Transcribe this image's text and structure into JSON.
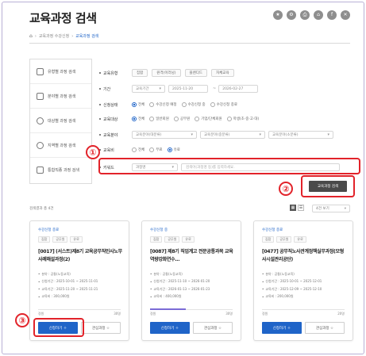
{
  "page": {
    "title": "교육과정 검색",
    "share_icons": [
      "★",
      "⚙",
      "⎙",
      "⌂",
      "f",
      "✕"
    ]
  },
  "breadcrumb": {
    "home_icon": "⌂",
    "items": [
      "교육과정 수강신청",
      "교육과정 검색"
    ]
  },
  "left_menu": [
    {
      "label": "유형별 과정 검색",
      "icon": "calendar-icon"
    },
    {
      "label": "분야별 과정 검색",
      "icon": "book-icon"
    },
    {
      "label": "대상별 과정 검색",
      "icon": "people-icon"
    },
    {
      "label": "지역별 과정 검색",
      "icon": "globe-icon"
    },
    {
      "label": "통합직종 과정 검색",
      "icon": "document-icon"
    }
  ],
  "filters": {
    "edu_type": {
      "label": "교육유형",
      "chips": [
        "집합",
        "원격(이러닝)",
        "블렌디드",
        "자체교육"
      ]
    },
    "period": {
      "label": "기간",
      "select": "교육기간",
      "start": "2025-11-20",
      "end": "2026-02-27"
    },
    "apply_status": {
      "label": "신청상태",
      "options": [
        "전체",
        "수강신청 예정",
        "수강신청 중",
        "수강신청 종료"
      ],
      "selected": 0
    },
    "edu_target": {
      "label": "교육대상",
      "options": [
        "전체",
        "일반회원",
        "공무원",
        "기업/단체회원",
        "학생(초·중·고·대)"
      ],
      "selected": 0
    },
    "edu_field": {
      "label": "교육분야",
      "selects": [
        "교육분야(대분류)",
        "교육분야(중분류)",
        "교육분야(소분류)"
      ]
    },
    "edu_cost": {
      "label": "교육비",
      "options": [
        "전체",
        "무료",
        "유료"
      ],
      "selected": 2
    },
    "keyword": {
      "label": "키워드",
      "select": "과정명",
      "placeholder": "검색어(과정명 등)를 입력하세요."
    }
  },
  "search_button": "교육과정 검색",
  "results": {
    "count_text": "검색결과 총 4건",
    "view_toggle": [
      "▦",
      "☰"
    ],
    "per_page": "4건 보기"
  },
  "cards": [
    {
      "status": "수강신청 종료",
      "tags": [
        "집합",
        "공무원",
        "유료"
      ],
      "title": "[0017] (서스트)제8기 교육공무직인사노무사례해설과정(2)",
      "info": [
        "분야 : 공통(노동교육)",
        "신청기간 : 2025-10-01 ~ 2025-11-01",
        "교육기간 : 2025-11-20 ~ 2025-11-21",
        "교육비 : 300,000원"
      ],
      "cap_left": "정원",
      "cap_right": "30명",
      "progress": 0,
      "apply": "신청하기 ＋",
      "fav": "관심과정 ☆"
    },
    {
      "status": "수강신청 중",
      "tags": [
        "집합",
        "공무원",
        "유료"
      ],
      "title": "[0087] 제8기 직업계고 전문공통과목 교육역량강화연수...",
      "info": [
        "분야 : 공통(노동교육)",
        "신청기간 : 2025-11-10 ~ 2026-01-20",
        "교육기간 : 2026-01-13 ~ 2026-01-23",
        "교육비 : 400,000원"
      ],
      "cap_left": "정원",
      "cap_right": "30명",
      "progress": 0.42,
      "apply": "신청하기 ＋",
      "fav": "관심과정 ☆"
    },
    {
      "status": "수강신청 종료",
      "tags": [
        "집합",
        "공무원",
        "유료"
      ],
      "title": "[0477] 공무직노사관계정책실무과정(모형사시설관리공단)",
      "info": [
        "분야 : 공통(노동교육)",
        "신청기간 : 2025-10-01 ~ 2025-12-01",
        "교육기간 : 2025-12-09 ~ 2025-12-10",
        "교육비 : 200,000원"
      ],
      "cap_left": "정원",
      "cap_right": "20명",
      "progress": 0,
      "apply": "신청하기 ＋",
      "fav": "관심과정 ☆"
    }
  ],
  "annotations": [
    "①",
    "②",
    "③"
  ],
  "colors": {
    "annotation": "#e2232a",
    "primary": "#1f64c8",
    "frame": "#b9b0d6"
  }
}
